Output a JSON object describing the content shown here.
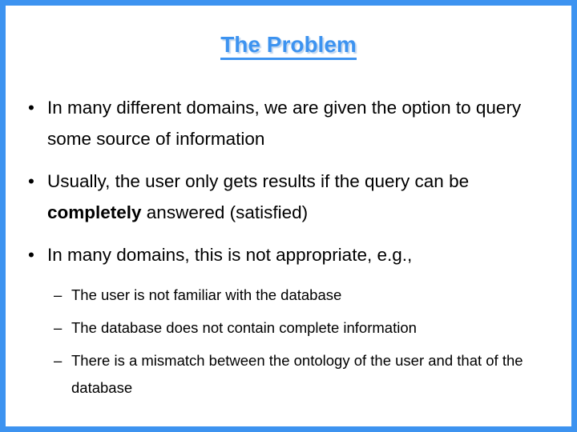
{
  "slide": {
    "title": "The Problem",
    "accent_color": "#3d93f0",
    "border_color": "#3d93f0",
    "background_color": "#ffffff",
    "text_color": "#000000",
    "bullet_marker": "•",
    "sub_bullet_marker": "–",
    "bullets": [
      {
        "level": 1,
        "text_before_bold": "In many different domains, we are given the option to query some source of information",
        "bold": "",
        "text_after_bold": ""
      },
      {
        "level": 1,
        "text_before_bold": "Usually, the user only gets results if the query can be ",
        "bold": "completely",
        "text_after_bold": " answered (satisfied)"
      },
      {
        "level": 1,
        "text_before_bold": "In many domains, this is not appropriate, e.g.,",
        "bold": "",
        "text_after_bold": ""
      }
    ],
    "sub_bullets": [
      "The user is not familiar with the database",
      "The database does not contain complete information",
      "There is a mismatch between the ontology of the user and that of the database"
    ]
  }
}
